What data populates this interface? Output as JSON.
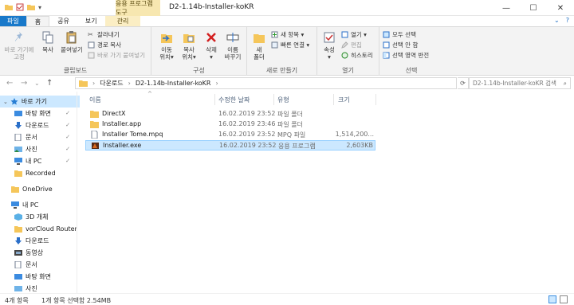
{
  "window": {
    "title": "D2-1.14b-Installer-koKR",
    "context_tab_header": "응용 프로그램 도구",
    "controls": {
      "minimize": "—",
      "maximize": "☐",
      "close": "✕"
    }
  },
  "tabs": {
    "file": "파일",
    "home": "홈",
    "share": "공유",
    "view": "보기",
    "manage": "관리",
    "expand": "⌄",
    "help": "?"
  },
  "ribbon": {
    "clipboard": {
      "label": "클립보드",
      "pin": "바로 가기에\n고정",
      "copy": "복사",
      "paste": "붙여넣기",
      "cut": "잘라내기",
      "copy_path": "경로 복사",
      "paste_shortcut": "바로 가기 붙여넣기"
    },
    "organize": {
      "label": "구성",
      "move_to": "이동\n위치▾",
      "copy_to": "복사\n위치▾",
      "delete": "삭제\n▾",
      "rename": "이름\n바꾸기"
    },
    "new": {
      "label": "새로 만들기",
      "new_folder": "새\n폴더",
      "new_item": "새 항목 ▾",
      "easy_access": "빠른 연결 ▾"
    },
    "open": {
      "label": "열기",
      "properties": "속성\n▾",
      "open": "열기 ▾",
      "edit": "편집",
      "history": "히스토리"
    },
    "select": {
      "label": "선택",
      "select_all": "모두 선택",
      "select_none": "선택 안 함",
      "invert": "선택 영역 반전"
    }
  },
  "address": {
    "back": "←",
    "forward": "→",
    "up_list": "⌄",
    "up": "↑",
    "crumbs": [
      "다운로드",
      "D2-1.14b-Installer-koKR"
    ],
    "separator": "›",
    "refresh": "⟳",
    "search_placeholder": "D2-1.14b-Installer-koKR 검색",
    "search_icon": "⌕"
  },
  "nav": {
    "quick_access": "바로 가기",
    "items": [
      {
        "label": "바탕 화면",
        "pinned": true
      },
      {
        "label": "다운로드",
        "pinned": true
      },
      {
        "label": "문서",
        "pinned": true
      },
      {
        "label": "사진",
        "pinned": true
      },
      {
        "label": "내 PC",
        "pinned": true
      },
      {
        "label": "Recorded",
        "pinned": false
      }
    ],
    "onedrive": "OneDrive",
    "this_pc": "내 PC",
    "pc_items": [
      "3D 개체",
      "vorCloud Router",
      "다운로드",
      "동영상",
      "문서",
      "바탕 화면",
      "사진"
    ],
    "pin_glyph": "📌"
  },
  "columns": {
    "name": "이름",
    "date": "수정한 날짜",
    "type": "유형",
    "size": "크기",
    "sort_glyph": "^"
  },
  "files": [
    {
      "name": "DirectX",
      "date": "16.02.2019 23:52",
      "type": "파일 폴더",
      "size": "",
      "kind": "folder"
    },
    {
      "name": "Installer.app",
      "date": "16.02.2019 23:46",
      "type": "파일 폴더",
      "size": "",
      "kind": "folder"
    },
    {
      "name": "Installer Tome.mpq",
      "date": "16.02.2019 23:52",
      "type": "MPQ 파일",
      "size": "1,514,200...",
      "kind": "file"
    },
    {
      "name": "Installer.exe",
      "date": "16.02.2019 23:52",
      "type": "응용 프로그램",
      "size": "2,603KB",
      "kind": "exe",
      "selected": true
    }
  ],
  "status": {
    "item_count": "4개 항목",
    "selection": "1개 항목 선택함 2.54MB"
  },
  "colors": {
    "accent": "#1979ca",
    "selection": "#cce8ff",
    "folder": "#f5c65a",
    "context": "#fbeec4"
  }
}
